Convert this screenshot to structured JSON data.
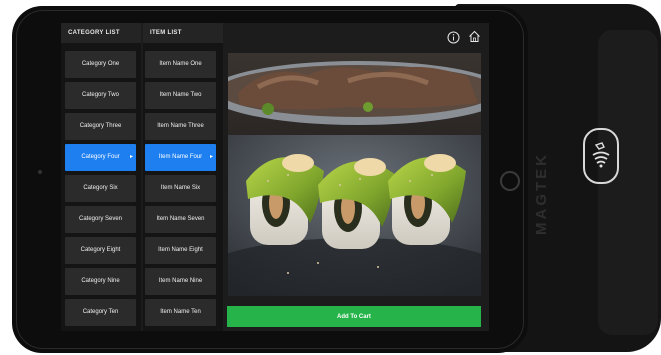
{
  "device": {
    "brand": "MAGTEK"
  },
  "menu": {
    "category_header": "CATEGORY LIST",
    "item_header": "ITEM LIST",
    "categories": [
      "Category One",
      "Category Two",
      "Category Three",
      "Category Four",
      "Category Six",
      "Category Seven",
      "Category Eight",
      "Category Nine",
      "Category Ten"
    ],
    "items": [
      "Item Name One",
      "Item Name Two",
      "Item Name Three",
      "Item Name Four",
      "Item Name Six",
      "Item Name Seven",
      "Item Name Eight",
      "Item Name Nine",
      "Item Name Ten"
    ],
    "selected_category": "Category Four",
    "selected_item": "Item Name Four"
  },
  "toolbar": {
    "info_icon": "info-icon",
    "home_icon": "home-icon"
  },
  "product": {
    "add_to_cart": "Add To Cart"
  },
  "colors": {
    "accent_blue": "#1e7ff0",
    "cart_green": "#26b34a"
  }
}
